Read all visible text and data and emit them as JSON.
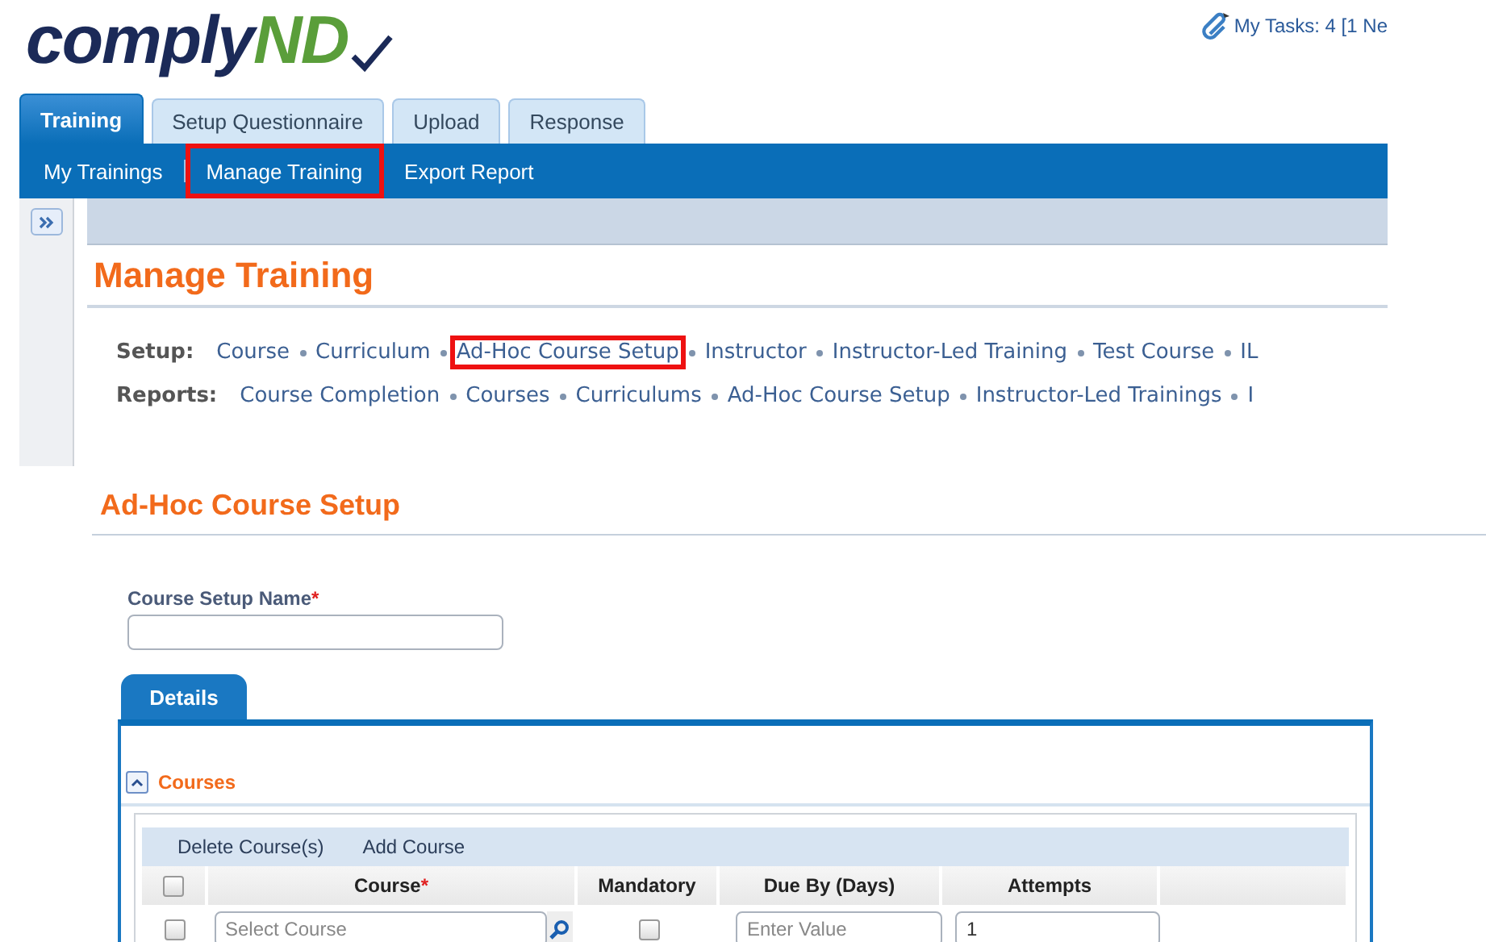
{
  "header": {
    "logo": {
      "main": "comply",
      "accent": "ND"
    },
    "tasks": "My Tasks: 4 [1 Ne"
  },
  "tabs": [
    {
      "label": "Training",
      "selected": true
    },
    {
      "label": "Setup Questionnaire",
      "selected": false
    },
    {
      "label": "Upload",
      "selected": false
    },
    {
      "label": "Response",
      "selected": false
    }
  ],
  "subnav": [
    {
      "label": "My Trainings",
      "highlighted": false
    },
    {
      "label": "Manage Training",
      "highlighted": true
    },
    {
      "label": "Export Report",
      "highlighted": false
    }
  ],
  "page_title": "Manage Training",
  "link_rows": [
    {
      "label": "Setup:",
      "links": [
        {
          "text": "Course",
          "highlighted": false
        },
        {
          "text": "Curriculum",
          "highlighted": false
        },
        {
          "text": "Ad-Hoc Course Setup",
          "highlighted": true
        },
        {
          "text": "Instructor",
          "highlighted": false
        },
        {
          "text": "Instructor-Led Training",
          "highlighted": false
        },
        {
          "text": "Test Course",
          "highlighted": false
        },
        {
          "text": "IL",
          "highlighted": false
        }
      ]
    },
    {
      "label": "Reports:",
      "links": [
        {
          "text": "Course Completion",
          "highlighted": false
        },
        {
          "text": "Courses",
          "highlighted": false
        },
        {
          "text": "Curriculums",
          "highlighted": false
        },
        {
          "text": "Ad-Hoc Course Setup",
          "highlighted": false
        },
        {
          "text": "Instructor-Led Trainings",
          "highlighted": false
        },
        {
          "text": "I",
          "highlighted": false
        }
      ]
    }
  ],
  "form": {
    "title": "Ad-Hoc Course Setup",
    "name_field": {
      "label": "Course Setup Name",
      "required_mark": "*"
    },
    "detail_tabs": [
      {
        "label": "Details",
        "selected": true
      }
    ],
    "section": {
      "title": "Courses",
      "expanded": true
    },
    "toolbar": [
      "Delete Course(s)",
      "Add Course"
    ],
    "columns": [
      {
        "kind": "checkbox",
        "checked": false
      },
      {
        "kind": "text",
        "label": "Course",
        "required_mark": "*"
      },
      {
        "kind": "text",
        "label": "Mandatory"
      },
      {
        "kind": "text",
        "label": "Due By (Days)"
      },
      {
        "kind": "text",
        "label": "Attempts"
      },
      {
        "kind": "blank"
      }
    ],
    "rows": [
      {
        "selected": false,
        "course": {
          "placeholder": "Select Course"
        },
        "mandatory": false,
        "due_by": {
          "placeholder": "Enter Value"
        },
        "attempts": {
          "value": "1"
        }
      }
    ]
  }
}
